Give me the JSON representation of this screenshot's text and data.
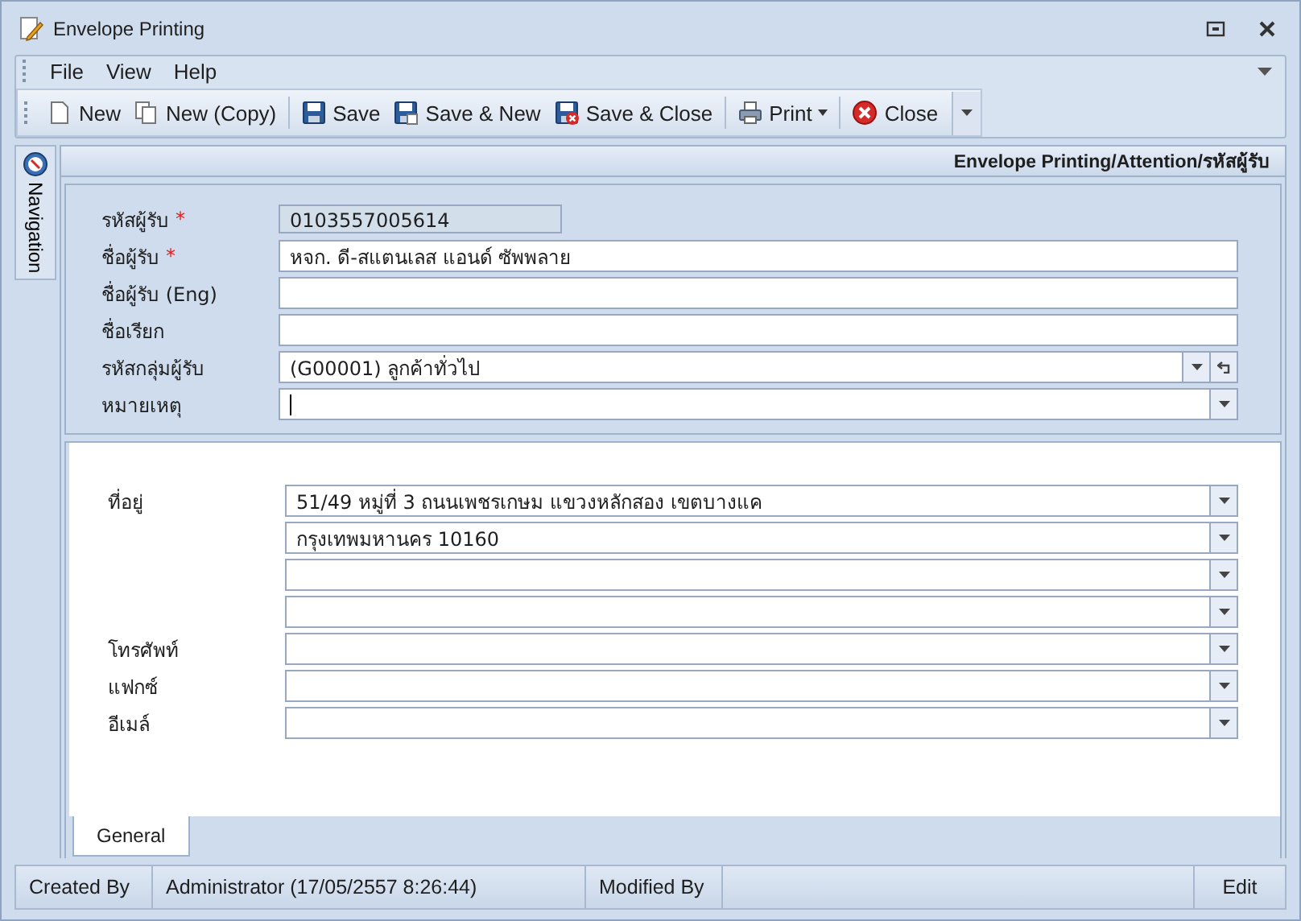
{
  "window": {
    "title": "Envelope Printing"
  },
  "menu": [
    "File",
    "View",
    "Help"
  ],
  "toolbar": [
    {
      "buttons": [
        {
          "label": "New",
          "kind": "new",
          "dropdown": false
        },
        {
          "label": "New (Copy)",
          "kind": "copy",
          "dropdown": false
        }
      ]
    },
    {
      "buttons": [
        {
          "label": "Save",
          "kind": "save",
          "dropdown": false
        },
        {
          "label": "Save & New",
          "kind": "save-new",
          "dropdown": false
        },
        {
          "label": "Save & Close",
          "kind": "save-close",
          "dropdown": false
        }
      ]
    },
    {
      "buttons": [
        {
          "label": "Print",
          "kind": "print",
          "dropdown": true
        }
      ]
    },
    {
      "buttons": [
        {
          "label": "Close",
          "kind": "close",
          "dropdown": false
        }
      ]
    }
  ],
  "navigation": {
    "label": "Navigation"
  },
  "breadcrumb": "Envelope Printing/Attention/รหัสผู้รับ",
  "header_fields": [
    {
      "label": "รหัสผู้รับ",
      "required_mark": "*",
      "kind": "readonly",
      "value": "0103557005614",
      "focused": false
    },
    {
      "label": "ชื่อผู้รับ",
      "required_mark": "*",
      "kind": "text",
      "value": "หจก. ดี-สแตนเลส แอนด์ ซัพพลาย",
      "focused": false
    },
    {
      "label": "ชื่อผู้รับ (Eng)",
      "kind": "text",
      "focused": false
    },
    {
      "label": "ชื่อเรียก",
      "kind": "text",
      "focused": false
    },
    {
      "label": "รหัสกลุ่มผู้รับ",
      "kind": "combo-reset",
      "value": "(G00001) ลูกค้าทั่วไป",
      "focused": false
    },
    {
      "label": "หมายเหตุ",
      "kind": "combo",
      "focused": true
    }
  ],
  "address_fields": [
    {
      "label": "ที่อยู่",
      "kind": "combo",
      "value": "51/49 หมู่ที่ 3 ถนนเพชรเกษม แขวงหลักสอง เขตบางแค"
    },
    {
      "kind": "combo",
      "value": "กรุงเทพมหานคร 10160"
    },
    {
      "kind": "combo"
    },
    {
      "kind": "combo"
    },
    {
      "label": "โทรศัพท์",
      "kind": "combo"
    },
    {
      "label": "แฟกซ์",
      "kind": "combo"
    },
    {
      "label": "อีเมล์",
      "kind": "combo"
    }
  ],
  "tabs": [
    {
      "label": "General",
      "selected": true
    }
  ],
  "status_bar": {
    "created_by_label": "Created By",
    "created_by": "Administrator (17/05/2557 8:26:44)",
    "modified_by_label": "Modified By",
    "mode": "Edit"
  }
}
